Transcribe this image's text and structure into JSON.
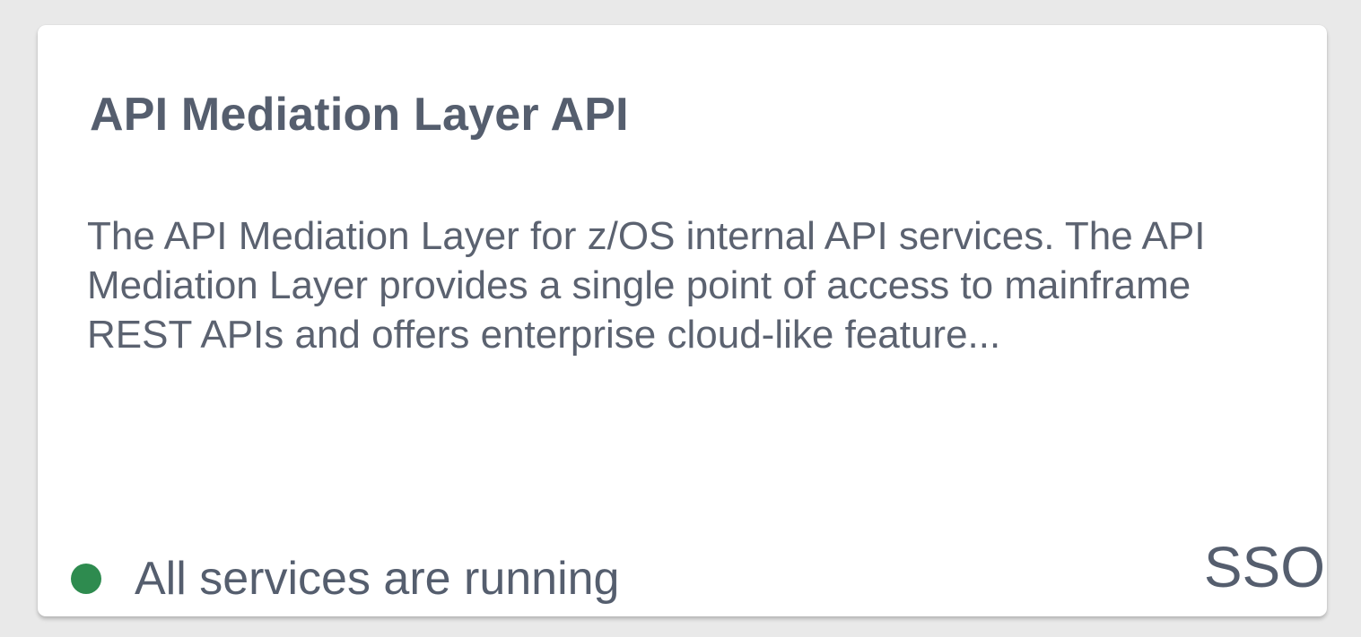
{
  "tile": {
    "title": "API Mediation Layer API",
    "description": "The API Mediation Layer for z/OS internal API services. The API Mediation Layer provides a single point of access to mainframe REST APIs and offers enterprise cloud-like feature...",
    "status": {
      "text": "All services are running",
      "indicator_color": "#2e8b4f",
      "icon": "status-dot-icon"
    },
    "sso_label": "SSO"
  },
  "colors": {
    "background": "#e9e9e9",
    "card": "#ffffff",
    "text": "#555e6e",
    "status_ok": "#2e8b4f"
  }
}
